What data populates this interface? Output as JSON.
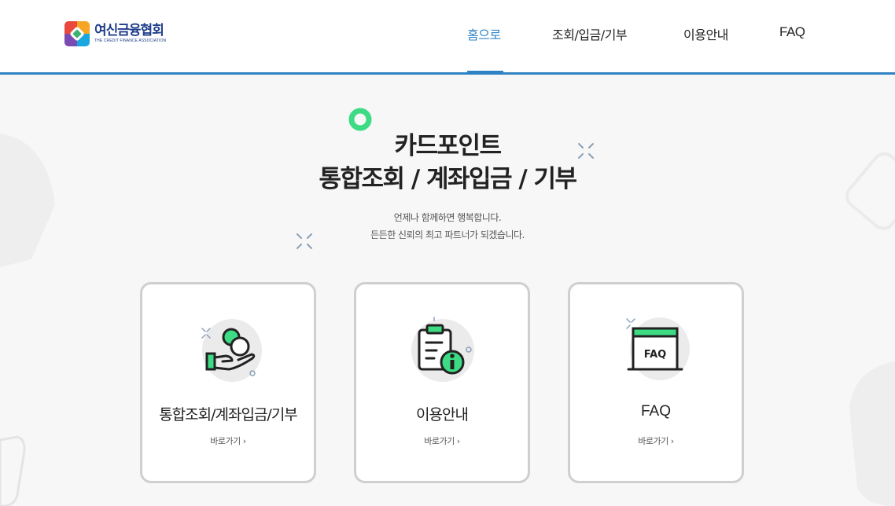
{
  "header": {
    "logo": {
      "name": "여신금융협회",
      "subtitle": "THE CREDIT FINANCE ASSOCIATION"
    },
    "nav": [
      {
        "label": "홈으로",
        "active": true
      },
      {
        "label": "조회/입금/기부",
        "active": false
      },
      {
        "label": "이용안내",
        "active": false
      },
      {
        "label": "FAQ",
        "active": false
      }
    ]
  },
  "hero": {
    "title_line1": "카드포인트",
    "title_line2": "통합조회 / 계좌입금 / 기부",
    "desc_line1": "언제나 함께하면 행복합니다.",
    "desc_line2": "든든한 신뢰의 최고 파트너가 되겠습니다."
  },
  "cards": [
    {
      "title": "통합조회/계좌입금/기부",
      "link": "바로가기",
      "icon": "hand-coins-icon"
    },
    {
      "title": "이용안내",
      "link": "바로가기",
      "icon": "clipboard-info-icon"
    },
    {
      "title": "FAQ",
      "link": "바로가기",
      "icon": "faq-window-icon",
      "icon_text": "FAQ"
    }
  ],
  "colors": {
    "accent": "#2f83c5",
    "green": "#3ddc84",
    "logo_blue": "#1f3e8a"
  }
}
